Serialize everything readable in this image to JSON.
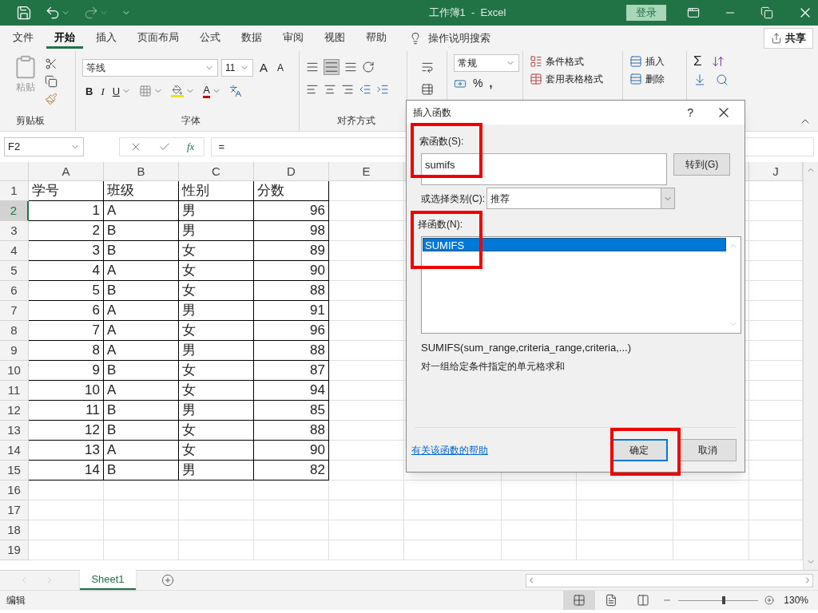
{
  "title_bar": {
    "title": "工作簿1  -  Excel",
    "sign_in": "登录",
    "redo_disabled": true
  },
  "menu_tabs": [
    {
      "label": "文件",
      "selected": false
    },
    {
      "label": "开始",
      "selected": true
    },
    {
      "label": "插入",
      "selected": false
    },
    {
      "label": "页面布局",
      "selected": false
    },
    {
      "label": "公式",
      "selected": false
    },
    {
      "label": "数据",
      "selected": false
    },
    {
      "label": "审阅",
      "selected": false
    },
    {
      "label": "视图",
      "selected": false
    },
    {
      "label": "帮助",
      "selected": false
    }
  ],
  "tell_me": "操作说明搜索",
  "share": "共享",
  "ribbon": {
    "clipboard": {
      "paste": "粘贴",
      "label": "剪贴板"
    },
    "font": {
      "name": "等线",
      "size": "11",
      "grow": "A",
      "shrink": "A",
      "bold": "B",
      "italic": "I",
      "underline": "U",
      "text_color": "A",
      "label": "字体"
    },
    "alignment": {
      "label": "对齐方式"
    },
    "number": {
      "format": "常规",
      "percent": "%",
      "comma": ","
    },
    "styles": [
      "条件格式",
      "套用表格格式"
    ],
    "cells": [
      "插入",
      "删除"
    ],
    "editing": {
      "sum": "Σ"
    }
  },
  "formula_bar": {
    "name_box": "F2",
    "fx": "fx",
    "formula": "="
  },
  "sheet": {
    "columns": [
      "A",
      "B",
      "C",
      "D",
      "E",
      "J"
    ],
    "rows": [
      {
        "header": "1",
        "selected": false,
        "kind": "header",
        "cells": [
          "学号",
          "班级",
          "性别",
          "分数"
        ]
      },
      {
        "header": "2",
        "selected": true,
        "kind": "data",
        "cells": [
          "1",
          "A",
          "男",
          "96"
        ]
      },
      {
        "header": "3",
        "selected": false,
        "kind": "data",
        "cells": [
          "2",
          "B",
          "男",
          "98"
        ]
      },
      {
        "header": "4",
        "selected": false,
        "kind": "data",
        "cells": [
          "3",
          "B",
          "女",
          "89"
        ]
      },
      {
        "header": "5",
        "selected": false,
        "kind": "data",
        "cells": [
          "4",
          "A",
          "女",
          "90"
        ]
      },
      {
        "header": "6",
        "selected": false,
        "kind": "data",
        "cells": [
          "5",
          "B",
          "女",
          "88"
        ]
      },
      {
        "header": "7",
        "selected": false,
        "kind": "data",
        "cells": [
          "6",
          "A",
          "男",
          "91"
        ]
      },
      {
        "header": "8",
        "selected": false,
        "kind": "data",
        "cells": [
          "7",
          "A",
          "女",
          "96"
        ]
      },
      {
        "header": "9",
        "selected": false,
        "kind": "data",
        "cells": [
          "8",
          "A",
          "男",
          "88"
        ]
      },
      {
        "header": "10",
        "selected": false,
        "kind": "data",
        "cells": [
          "9",
          "B",
          "女",
          "87"
        ]
      },
      {
        "header": "11",
        "selected": false,
        "kind": "data",
        "cells": [
          "10",
          "A",
          "女",
          "94"
        ]
      },
      {
        "header": "12",
        "selected": false,
        "kind": "data",
        "cells": [
          "11",
          "B",
          "男",
          "85"
        ]
      },
      {
        "header": "13",
        "selected": false,
        "kind": "data",
        "cells": [
          "12",
          "B",
          "女",
          "88"
        ]
      },
      {
        "header": "14",
        "selected": false,
        "kind": "data",
        "cells": [
          "13",
          "A",
          "女",
          "90"
        ]
      },
      {
        "header": "15",
        "selected": false,
        "kind": "data",
        "cells": [
          "14",
          "B",
          "男",
          "82"
        ]
      },
      {
        "header": "16",
        "selected": false,
        "kind": "empty"
      },
      {
        "header": "17",
        "selected": false,
        "kind": "empty"
      },
      {
        "header": "18",
        "selected": false,
        "kind": "empty"
      },
      {
        "header": "19",
        "selected": false,
        "kind": "empty"
      }
    ]
  },
  "dialog": {
    "title": "插入函数",
    "help": "?",
    "search_label": "索函数(S):",
    "search_value": "sumifs",
    "search_highlighted": true,
    "go_button": "转到(G)",
    "category_label": "或选择类别(C):",
    "category": "推荐",
    "list_label": "择函数(N):",
    "list_highlighted": true,
    "functions": [
      {
        "name": "SUMIFS",
        "selected": true
      }
    ],
    "signature": "SUMIFS(sum_range,criteria_range,criteria,...)",
    "description": "对一组给定条件指定的单元格求和",
    "help_link": "有关该函数的帮助",
    "ok": "确定",
    "ok_highlighted": true,
    "cancel": "取消"
  },
  "sheet_tabs": [
    {
      "label": "Sheet1",
      "selected": true
    }
  ],
  "status_bar": {
    "mode": "编辑",
    "zoom": "130%",
    "zoom_slider": {
      "level": 0.55
    }
  }
}
